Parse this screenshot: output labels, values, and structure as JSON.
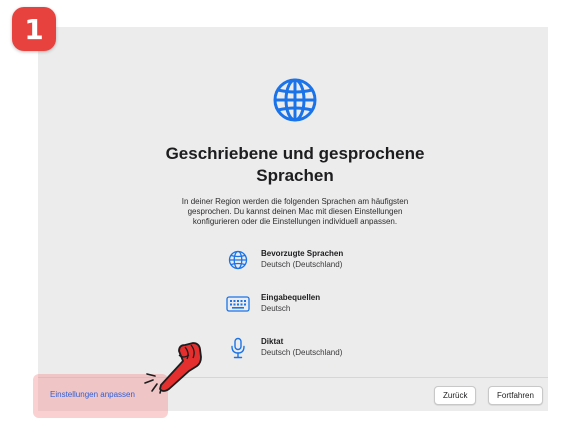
{
  "step_badge": "1",
  "heading": {
    "title_line1": "Geschriebene und gesprochene",
    "title_line2": "Sprachen",
    "description_line1": "In deiner Region werden die folgenden Sprachen am häufigsten",
    "description_line2": "gesprochen. Du kannst deinen Mac mit diesen Einstellungen",
    "description_line3": "konfigurieren oder die Einstellungen individuell anpassen."
  },
  "items": [
    {
      "icon": "globe-icon",
      "title": "Bevorzugte Sprachen",
      "subtitle": "Deutsch (Deutschland)"
    },
    {
      "icon": "keyboard-icon",
      "title": "Eingabequellen",
      "subtitle": "Deutsch"
    },
    {
      "icon": "microphone-icon",
      "title": "Diktat",
      "subtitle": "Deutsch (Deutschland)"
    }
  ],
  "footer": {
    "customize_link": "Einstellungen anpassen",
    "back_label": "Zurück",
    "continue_label": "Fortfahren"
  },
  "colors": {
    "accent": "#1a73e8",
    "link": "#2f5fd8",
    "badge": "#e8423f",
    "highlight": "#f49696",
    "pointer_hand": "#e52e2e"
  }
}
